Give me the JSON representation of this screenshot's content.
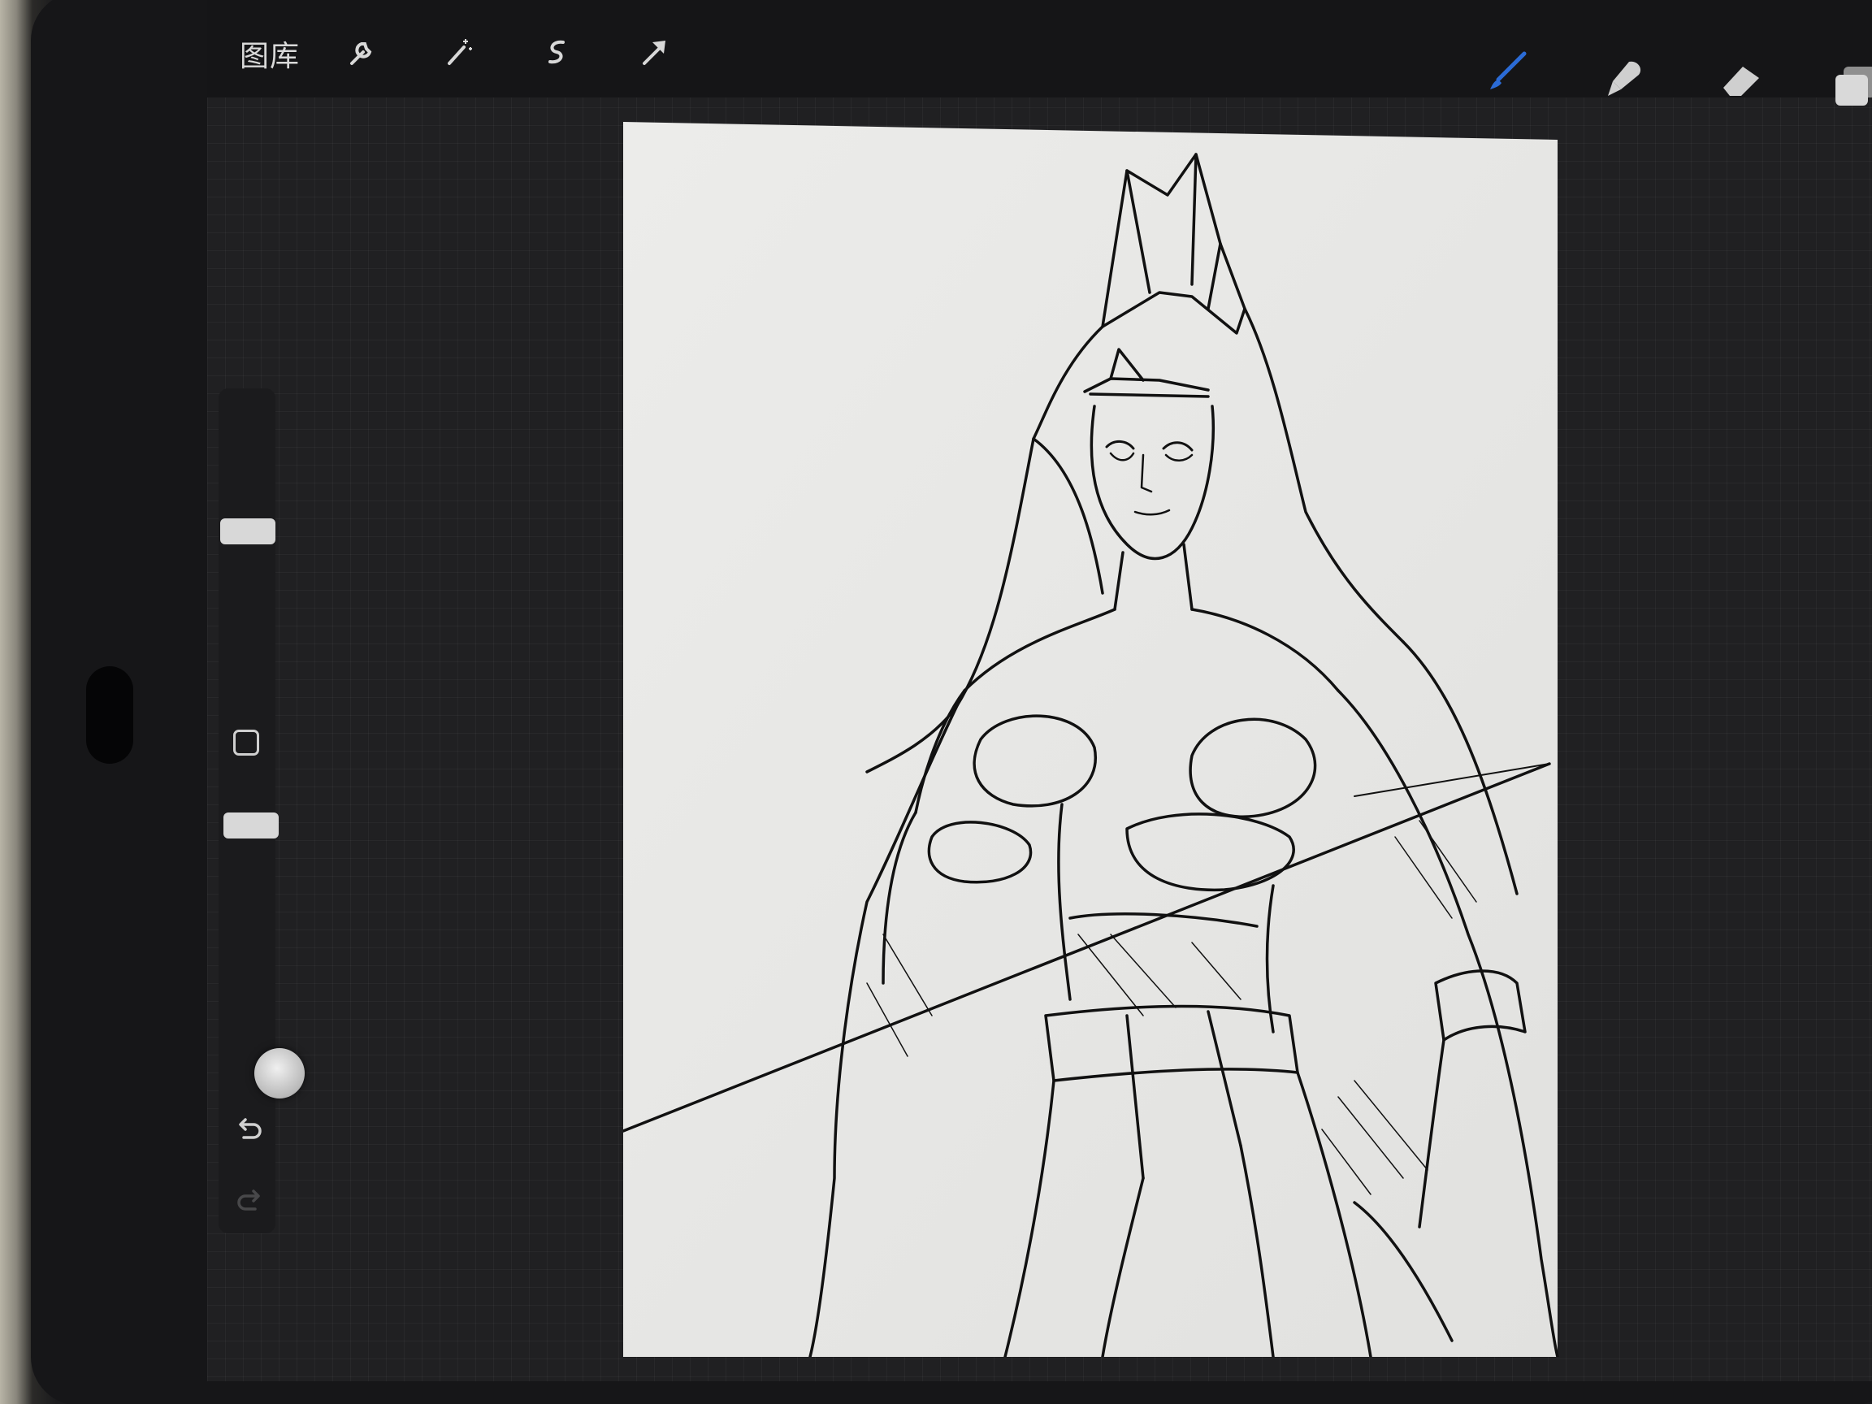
{
  "toolbar": {
    "gallery_label": "图库",
    "left_icons": [
      "wrench-icon",
      "magic-wand-icon",
      "selection-s-icon",
      "transform-arrow-icon"
    ],
    "right_icons": [
      "brush-icon",
      "smudge-icon",
      "eraser-icon",
      "layers-icon"
    ],
    "active_tool": "brush",
    "active_color": "#2b6bd6"
  },
  "sidebar": {
    "brush_size_level": 0.55,
    "opacity_level": 0.45,
    "color_knob": "#c8c8c8"
  },
  "canvas": {
    "content": "sketch",
    "background": "#e9e9e7",
    "stroke_color": "#111111"
  }
}
